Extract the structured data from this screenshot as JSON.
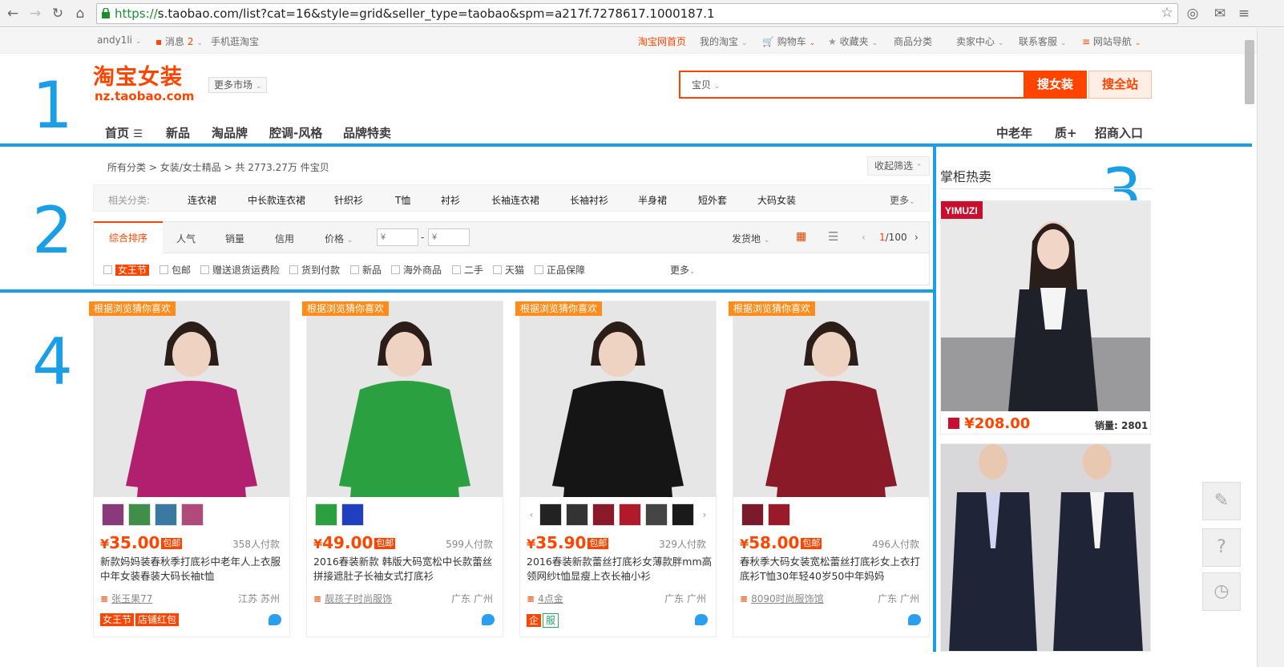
{
  "browser": {
    "url_scheme": "https://",
    "url_rest": "s.taobao.com/list?cat=16&style=grid&seller_type=taobao&spm=a217f.7278617.1000187.1"
  },
  "topbar": {
    "user": "andy1li",
    "messages_label": "消息",
    "messages_count": "2",
    "mobile": "手机逛淘宝",
    "home": "淘宝网首页",
    "my_taobao": "我的淘宝",
    "cart": "购物车",
    "favorites": "收藏夹",
    "categories": "商品分类",
    "seller_center": "卖家中心",
    "contact": "联系客服",
    "site_nav": "网站导航"
  },
  "header": {
    "logo_cn": "淘宝女装",
    "logo_en": "nz.taobao.com",
    "more_market": "更多市场",
    "search_scope": "宝贝",
    "search_value": "",
    "search_button": "搜女装",
    "search_all_button": "搜全站",
    "nav_left": [
      "首页",
      "新品",
      "淘品牌",
      "腔调-风格",
      "品牌特卖"
    ],
    "nav_right": [
      "中老年",
      "质+",
      "招商入口"
    ]
  },
  "annotations": [
    "1",
    "2",
    "3",
    "4"
  ],
  "filters": {
    "crumb_all": "所有分类",
    "crumb_cat": "女装/女士精品",
    "crumb_count": "共 2773.27万 件宝贝",
    "collapse": "收起筛选",
    "related_label": "相关分类:",
    "related": [
      "连衣裙",
      "中长款连衣裙",
      "针织衫",
      "T恤",
      "衬衫",
      "长袖连衣裙",
      "长袖衬衫",
      "半身裙",
      "短外套",
      "大码女装"
    ],
    "more": "更多",
    "sort": [
      "综合排序",
      "人气",
      "销量",
      "信用",
      "价格"
    ],
    "price_placeholder": "¥",
    "ship_from": "发货地",
    "page_current": "1",
    "page_total": "/100",
    "checks": [
      "女王节",
      "包邮",
      "赠送退货运费险",
      "货到付款",
      "新品",
      "海外商品",
      "二手",
      "天猫",
      "正品保障"
    ],
    "checks_more": "更多"
  },
  "products": [
    {
      "tag": "根据浏览猜你喜欢",
      "price": "35.00",
      "baoyou": "包邮",
      "sold": "358人付款",
      "title": "新款妈妈装春秋季打底衫中老年人上衣服中年女装春装大码长袖t恤",
      "shop": "张玉果77",
      "loc": "江苏 苏州",
      "badges": [
        "女王节",
        "店铺红包"
      ],
      "thumb_colors": [
        "#8a3a7a",
        "#3f8f4a",
        "#3a7aa0",
        "#b04a7a"
      ],
      "color": "#b0206e"
    },
    {
      "tag": "根据浏览猜你喜欢",
      "price": "49.00",
      "baoyou": "包邮",
      "sold": "599人付款",
      "title": "2016春装新款 韩版大码宽松中长款蕾丝拼接遮肚子长袖女式打底衫",
      "shop": "靓孩子时尚服饰",
      "loc": "广东 广州",
      "badges": [],
      "thumb_colors": [
        "#2aa040",
        "#1f3fc0"
      ],
      "color": "#2aa040"
    },
    {
      "tag": "根据浏览猜你喜欢",
      "price": "35.90",
      "baoyou": "包邮",
      "sold": "329人付款",
      "title": "2016春装新款蕾丝打底衫女薄款胖mm高领网纱t恤显瘦上衣长袖小衫",
      "shop": "4点金",
      "loc": "广东 广州",
      "badges": [
        "企",
        "服"
      ],
      "thumb_colors": [
        "#222222",
        "#333333",
        "#8a1a2a",
        "#b01a2a",
        "#444444",
        "#1a1a1a"
      ],
      "color": "#151515"
    },
    {
      "tag": "根据浏览猜你喜欢",
      "price": "58.00",
      "baoyou": "包邮",
      "sold": "496人付款",
      "title": "春秋季大码女装宽松蕾丝打底衫女上衣打底衫T恤30年轻40岁50中年妈妈",
      "shop": "8090时尚服饰馆",
      "loc": "广东 广州",
      "badges": [],
      "thumb_colors": [
        "#7a1a2a",
        "#9a1a2a"
      ],
      "color": "#8a1a28"
    }
  ],
  "sidebar": {
    "title": "掌柜热卖",
    "brand": "YIMUZI",
    "price": "208.00",
    "sold": "销量: 2801"
  },
  "tools": [
    "pencil-icon",
    "question-icon",
    "clock-icon"
  ],
  "colors": {
    "accent": "#ff4400",
    "annotation": "#1a9ee6",
    "tag": "#ff8c1a"
  }
}
